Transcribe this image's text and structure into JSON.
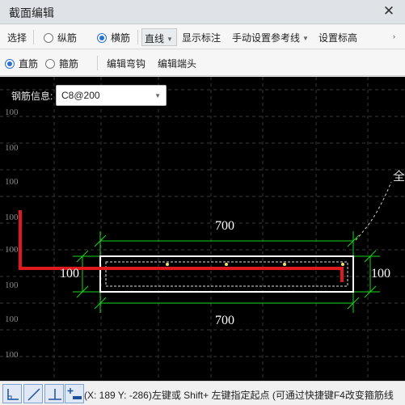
{
  "window": {
    "title": "截面编辑",
    "close_glyph": "✕"
  },
  "toolbar1": {
    "select_label": "选择",
    "longitudinal_label": "纵筋",
    "transverse_label": "横筋",
    "line_mode_label": "直线",
    "show_dims_label": "显示标注",
    "manual_ref_label": "手动设置参考线",
    "set_elevation_label": "设置标高",
    "selected_mode": "横筋"
  },
  "toolbar2": {
    "straight_label": "直筋",
    "stirrup_label": "箍筋",
    "edit_hook_label": "编辑弯钩",
    "edit_end_label": "编辑端头",
    "selected_mode": "直筋"
  },
  "canvas": {
    "rebar_info_label": "钢筋信息:",
    "rebar_info_value": "C8@200",
    "grid_label": "100",
    "grid_label_count": 10,
    "dims": {
      "top": "700",
      "bottom": "700",
      "left": "100",
      "right": "100"
    },
    "edge_glyph": "全",
    "colors": {
      "background": "#000000",
      "rebar": "#e0191f",
      "outline": "#ffffff",
      "dimension": "#19d619",
      "grid": "#3a3a3a"
    }
  },
  "statusbar": {
    "tool_icons": [
      "orthogonal-icon",
      "diagonal-line-icon",
      "perpendicular-icon",
      "add-point-icon"
    ],
    "message": "(X: 189 Y: -286)左键或 Shift+ 左键指定起点 (可通过快捷键F4改变箍筋线"
  }
}
